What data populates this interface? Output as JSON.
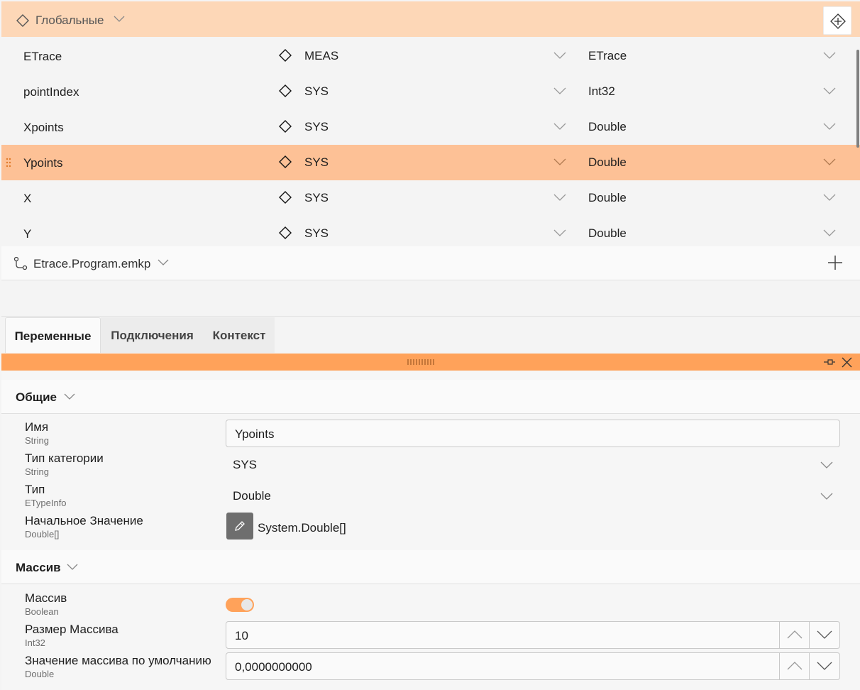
{
  "globals": {
    "title": "Глобальные",
    "variables": [
      {
        "name": "ETrace",
        "category": "MEAS",
        "type": "ETrace",
        "selected": false
      },
      {
        "name": "pointIndex",
        "category": "SYS",
        "type": "Int32",
        "selected": false
      },
      {
        "name": "Xpoints",
        "category": "SYS",
        "type": "Double",
        "selected": false
      },
      {
        "name": "Ypoints",
        "category": "SYS",
        "type": "Double",
        "selected": true
      },
      {
        "name": "X",
        "category": "SYS",
        "type": "Double",
        "selected": false
      },
      {
        "name": "Y",
        "category": "SYS",
        "type": "Double",
        "selected": false
      }
    ]
  },
  "program": {
    "title": "Etrace.Program.emkp"
  },
  "tabs": [
    {
      "label": "Переменные",
      "active": true
    },
    {
      "label": "Подключения",
      "active": false
    },
    {
      "label": "Контекст",
      "active": false
    }
  ],
  "properties": {
    "general": {
      "title": "Общие",
      "name": {
        "label": "Имя",
        "type": "String",
        "value": "Ypoints"
      },
      "category": {
        "label": "Тип категории",
        "type": "String",
        "value": "SYS"
      },
      "type": {
        "label": "Тип",
        "type": "ETypeInfo",
        "value": "Double"
      },
      "initial": {
        "label": "Начальное Значение",
        "type": "Double[]",
        "value": "System.Double[]"
      }
    },
    "array": {
      "title": "Массив",
      "is_array": {
        "label": "Массив",
        "type": "Boolean",
        "value": true
      },
      "size": {
        "label": "Размер Массива",
        "type": "Int32",
        "value": "10"
      },
      "default": {
        "label": "Значение массива по умолчанию",
        "type": "Double",
        "value": "0,0000000000"
      }
    }
  },
  "colors": {
    "header": "#fdd7b7",
    "selected_row": "#fdc196",
    "accent": "#ffa25a"
  }
}
